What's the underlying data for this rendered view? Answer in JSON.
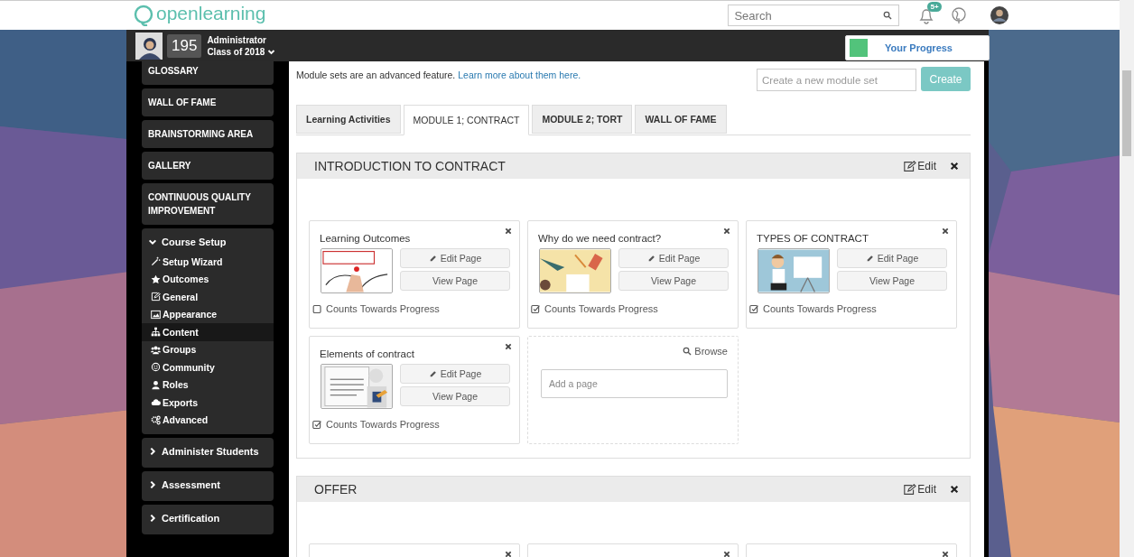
{
  "header": {
    "logo": "openlearning",
    "search": {
      "placeholder": "Search"
    },
    "notification_badge": "5+"
  },
  "user_bar": {
    "points": "195",
    "role": "Administrator",
    "group": "Class of 2018",
    "progress_label": "Your Progress"
  },
  "sidebar": {
    "items": [
      {
        "kind": "link",
        "label": "GLOSSARY"
      },
      {
        "kind": "link",
        "label": "WALL OF FAME"
      },
      {
        "kind": "link",
        "label": "BRAINSTORMING AREA"
      },
      {
        "kind": "link",
        "label": "GALLERY"
      },
      {
        "kind": "link",
        "label": "CONTINUOUS QUALITY IMPROVEMENT"
      },
      {
        "kind": "group",
        "label": "Course Setup",
        "expanded": true,
        "children": [
          {
            "label": "Setup Wizard",
            "selected": false
          },
          {
            "label": "Outcomes",
            "selected": false
          },
          {
            "label": "General",
            "selected": false
          },
          {
            "label": "Appearance",
            "selected": false
          },
          {
            "label": "Content",
            "selected": true
          },
          {
            "label": "Groups",
            "selected": false
          },
          {
            "label": "Community",
            "selected": false
          },
          {
            "label": "Roles",
            "selected": false
          },
          {
            "label": "Exports",
            "selected": false
          },
          {
            "label": "Advanced",
            "selected": false
          }
        ]
      },
      {
        "kind": "group",
        "label": "Administer Students",
        "expanded": false
      },
      {
        "kind": "group",
        "label": "Assessment",
        "expanded": false
      },
      {
        "kind": "group",
        "label": "Certification",
        "expanded": false
      }
    ]
  },
  "module_sets": {
    "note": "Module sets are an advanced feature.",
    "link": "Learn more about them here.",
    "new_set": {
      "placeholder": "Create a new module set"
    },
    "create_button": "Create"
  },
  "tabs": [
    {
      "label": "Learning Activities",
      "selected": false
    },
    {
      "label": "MODULE 1; CONTRACT",
      "selected": true
    },
    {
      "label": "MODULE 2; TORT",
      "selected": false
    },
    {
      "label": "WALL OF FAME",
      "selected": false
    }
  ],
  "modules": [
    {
      "title": "INTRODUCTION TO CONTRACT",
      "edit": "Edit",
      "cards": [
        {
          "kind": "page",
          "title": "Learning Outcomes",
          "edit": "Edit Page",
          "view": "View Page",
          "progress_label": "Counts Towards Progress",
          "checked": false
        },
        {
          "kind": "page",
          "title": "Why do we need contract?",
          "edit": "Edit Page",
          "view": "View Page",
          "progress_label": "Counts Towards Progress",
          "checked": true
        },
        {
          "kind": "page",
          "title": "TYPES OF CONTRACT",
          "edit": "Edit Page",
          "view": "View Page",
          "progress_label": "Counts Towards Progress",
          "checked": true
        },
        {
          "kind": "page",
          "title": "Elements of contract",
          "edit": "Edit Page",
          "view": "View Page",
          "progress_label": "Counts Towards Progress",
          "checked": true
        },
        {
          "kind": "add",
          "browse": "Browse",
          "placeholder": "Add a page"
        }
      ]
    },
    {
      "title": "OFFER",
      "edit": "Edit",
      "cards": [
        {
          "kind": "cut"
        },
        {
          "kind": "cut"
        },
        {
          "kind": "cut"
        }
      ]
    }
  ]
}
